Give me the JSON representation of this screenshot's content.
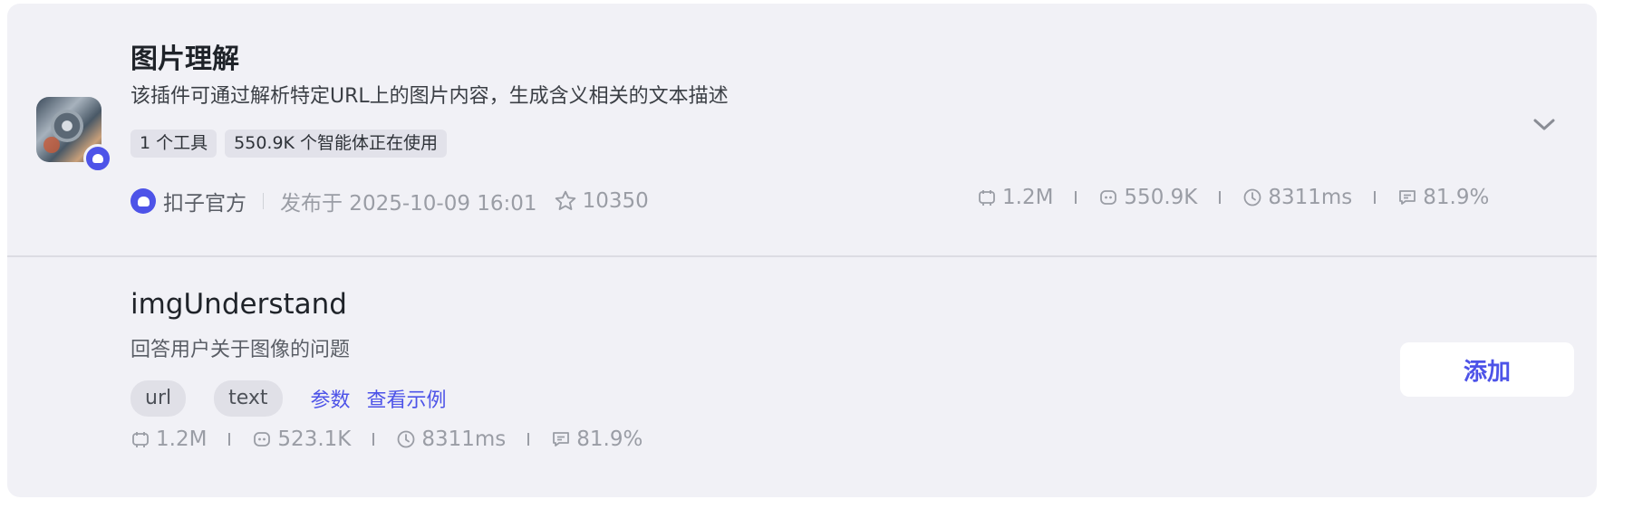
{
  "plugin": {
    "title": "图片理解",
    "description": "该插件可通过解析特定URL上的图片内容，生成含义相关的文本描述",
    "tags": [
      "1 个工具",
      "550.9K 个智能体正在使用"
    ],
    "owner": "扣子官方",
    "published": "发布于 2025-10-09 16:01",
    "stars": "10350",
    "stats": {
      "calls": "1.2M",
      "bots": "550.9K",
      "latency": "8311ms",
      "success_rate": "81.9%"
    }
  },
  "tool": {
    "title": "imgUnderstand",
    "description": "回答用户关于图像的问题",
    "params": [
      "url",
      "text"
    ],
    "links": {
      "params": "参数",
      "examples": "查看示例"
    },
    "add_label": "添加",
    "stats": {
      "calls": "1.2M",
      "bots": "523.1K",
      "latency": "8311ms",
      "success_rate": "81.9%"
    }
  },
  "colors": {
    "accent": "#4d53e8",
    "card_bg": "#f1f1f6",
    "muted_text": "#9a9da5"
  }
}
